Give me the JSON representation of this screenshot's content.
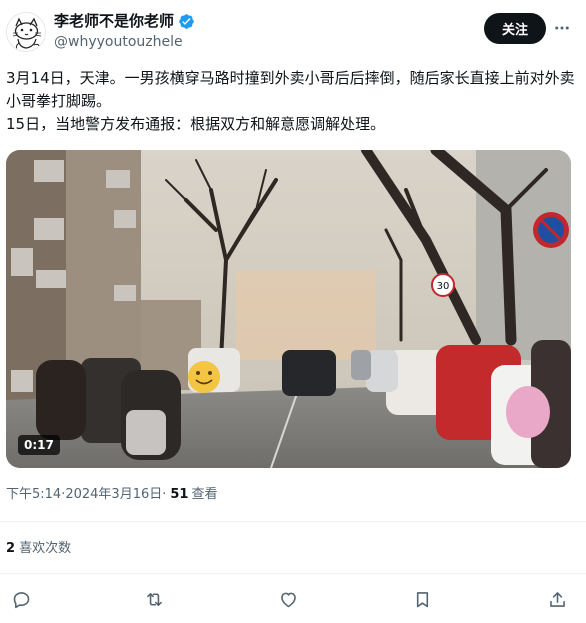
{
  "author": {
    "display_name": "李老师不是你老师",
    "handle": "@whyyoutouzhele",
    "verified": true,
    "avatar_icon": "cat-sketch-avatar"
  },
  "header": {
    "follow_label": "关注",
    "more_icon": "ellipsis-icon"
  },
  "tweet": {
    "lines": [
      "3月14日，天津。一男孩横穿马路时撞到外卖小哥后后摔倒，随后家长直接上前对外卖小哥拳打脚踢。",
      "15日，当地警方发布通报：根据双方和解意愿调解处理。"
    ]
  },
  "media": {
    "type": "video",
    "duration": "0:17",
    "scene": "street-with-cars-and-scooters",
    "sign_number": "30",
    "emoji_sticker": "smiley-face"
  },
  "meta": {
    "time": "下午5:14",
    "separator1": " · ",
    "date": "2024年3月16日",
    "separator2": " · ",
    "views_count": "51",
    "views_label": "查看"
  },
  "stats": {
    "likes_count": "2",
    "likes_label": " 喜欢次数"
  },
  "actions": [
    "reply-icon",
    "retweet-icon",
    "like-icon",
    "bookmark-icon",
    "share-icon"
  ],
  "colors": {
    "text_primary": "#0f1419",
    "text_secondary": "#536471",
    "verified_blue": "#1d9bf0",
    "divider": "#eff3f4"
  }
}
